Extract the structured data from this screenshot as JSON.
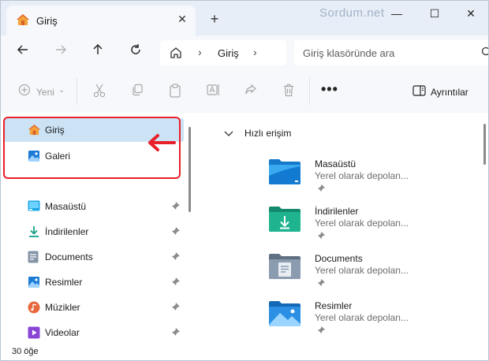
{
  "window": {
    "tab_title": "Giriş",
    "watermark": "Sordum.net",
    "new_tab": "+",
    "minimize": "—",
    "maximize": "☐",
    "close": "✕"
  },
  "nav": {
    "address_text": "Giriş",
    "search_placeholder": "Giriş klasöründe ara"
  },
  "commands": {
    "new_label": "Yeni",
    "more_label": "•••",
    "details_label": "Ayrıntılar"
  },
  "sidebar": {
    "items": [
      {
        "label": "Giriş",
        "icon": "home-icon",
        "pinned": false,
        "selected": true
      },
      {
        "label": "Galeri",
        "icon": "gallery-icon",
        "pinned": false,
        "selected": false
      },
      {
        "label": "Masaüstü",
        "icon": "desktop-folder-icon",
        "pinned": true
      },
      {
        "label": "İndirilenler",
        "icon": "downloads-icon",
        "pinned": true
      },
      {
        "label": "Documents",
        "icon": "documents-icon",
        "pinned": true
      },
      {
        "label": "Resimler",
        "icon": "pictures-icon",
        "pinned": true
      },
      {
        "label": "Müzikler",
        "icon": "music-icon",
        "pinned": true
      },
      {
        "label": "Videolar",
        "icon": "videos-icon",
        "pinned": true
      }
    ]
  },
  "main": {
    "section_title": "Hızlı erişim",
    "items": [
      {
        "name": "Masaüstü",
        "sub": "Yerel olarak depolan..."
      },
      {
        "name": "İndirilenler",
        "sub": "Yerel olarak depolan..."
      },
      {
        "name": "Documents",
        "sub": "Yerel olarak depolan..."
      },
      {
        "name": "Resimler",
        "sub": "Yerel olarak depolan..."
      }
    ]
  },
  "status": {
    "item_count": "30 öğe"
  },
  "colors": {
    "accent": "#0067c0",
    "selection": "#cce3f6",
    "highlight_border": "#e8202a",
    "titlebar": "#e8eef7"
  }
}
